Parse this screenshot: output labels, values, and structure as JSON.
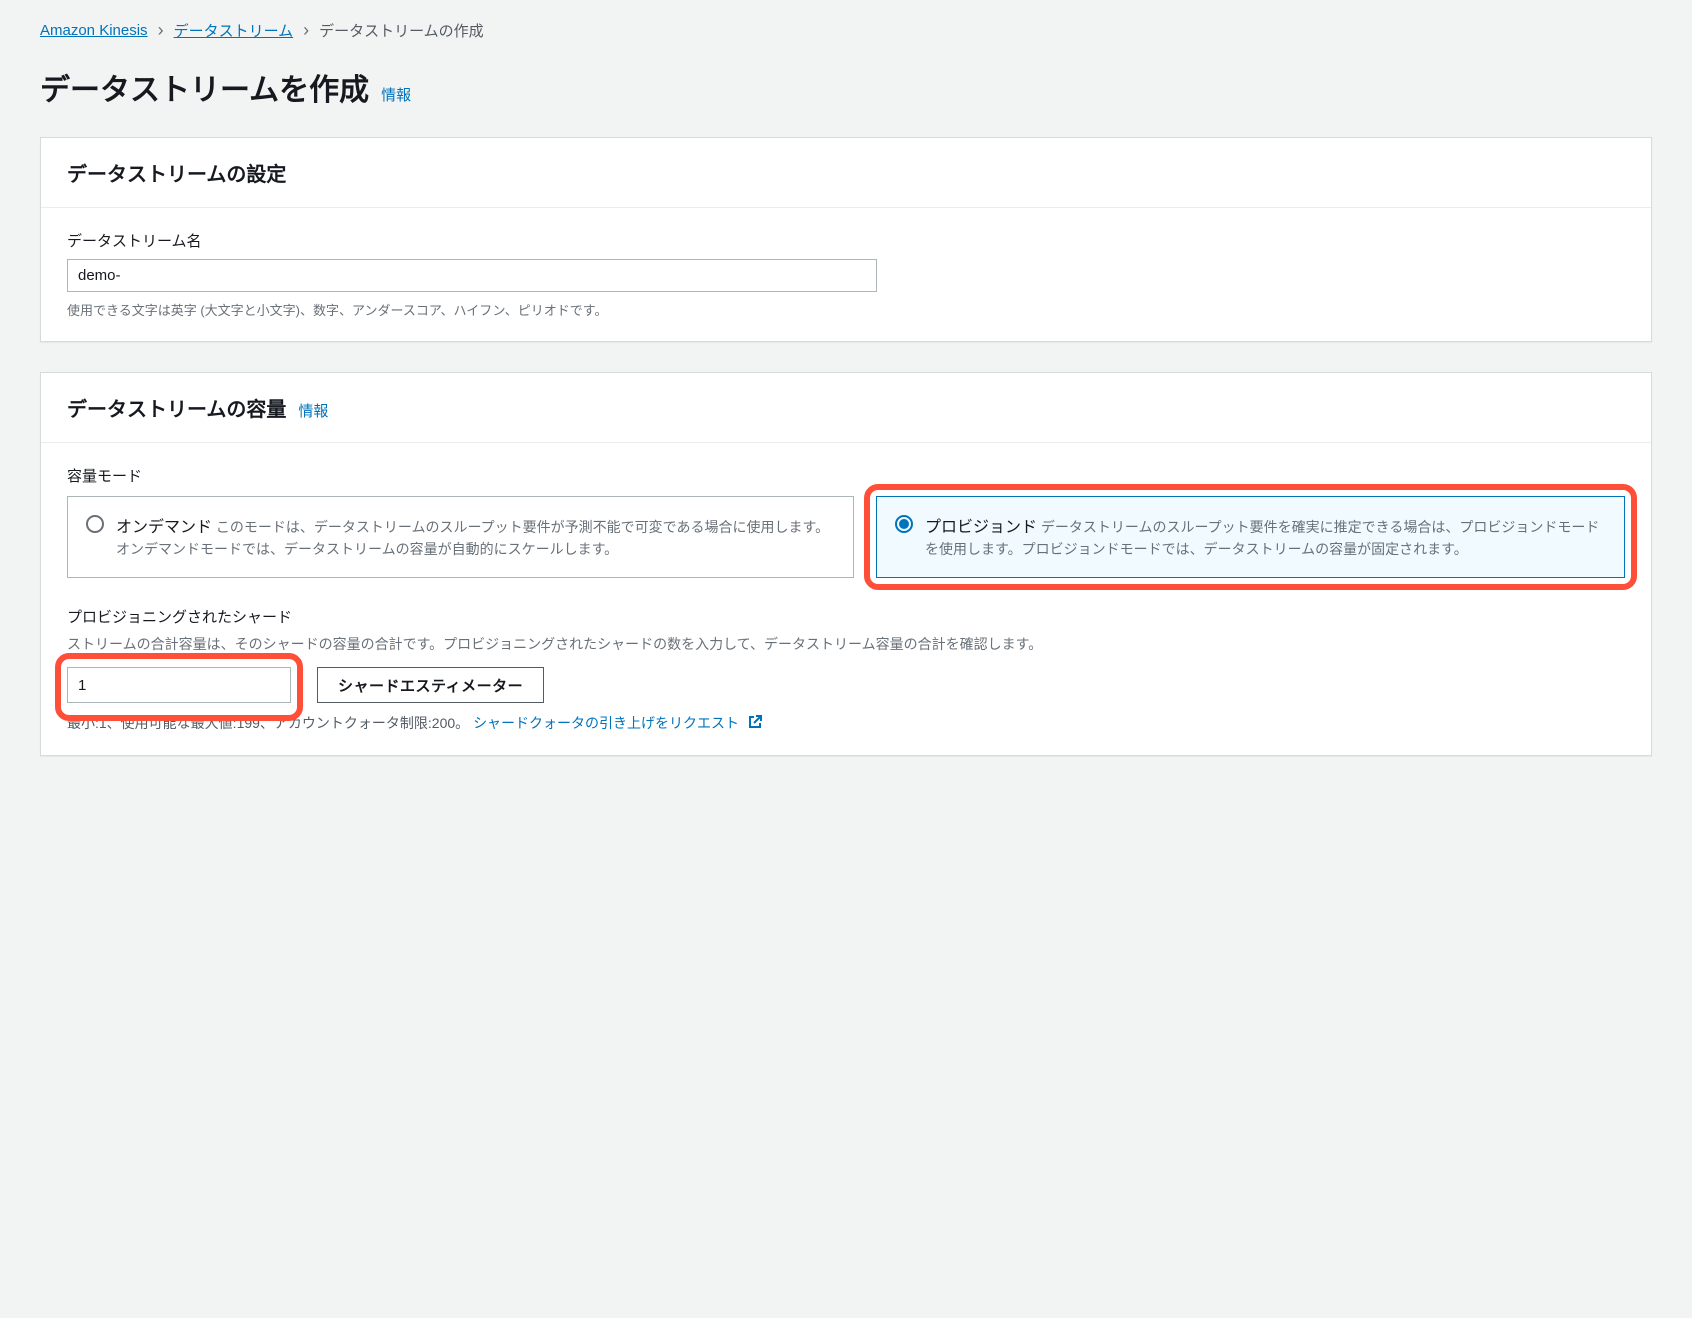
{
  "breadcrumb": {
    "service": "Amazon Kinesis",
    "section": "データストリーム",
    "current": "データストリームの作成"
  },
  "header": {
    "title": "データストリームを作成",
    "info": "情報"
  },
  "settingsPanel": {
    "title": "データストリームの設定",
    "nameLabel": "データストリーム名",
    "nameValue": "demo-",
    "nameHelper": "使用できる文字は英字 (大文字と小文字)、数字、アンダースコア、ハイフン、ピリオドです。"
  },
  "capacityPanel": {
    "title": "データストリームの容量",
    "info": "情報",
    "modeLabel": "容量モード",
    "options": {
      "onDemand": {
        "title": "オンデマンド",
        "desc": "このモードは、データストリームのスループット要件が予測不能で可変である場合に使用します。オンデマンドモードでは、データストリームの容量が自動的にスケールします。"
      },
      "provisioned": {
        "title": "プロビジョンド",
        "desc": "データストリームのスループット要件を確実に推定できる場合は、プロビジョンドモードを使用します。プロビジョンドモードでは、データストリームの容量が固定されます。"
      }
    },
    "shards": {
      "label": "プロビジョニングされたシャード",
      "desc": "ストリームの合計容量は、そのシャードの容量の合計です。プロビジョニングされたシャードの数を入力して、データストリーム容量の合計を確認します。",
      "value": "1",
      "estimatorBtn": "シャードエスティメーター",
      "constraintPrefix": "最小:1、使用可能な最大値:199、アカウントクォータ制限:200。",
      "quotaLink": "シャードクォータの引き上げをリクエスト"
    }
  }
}
